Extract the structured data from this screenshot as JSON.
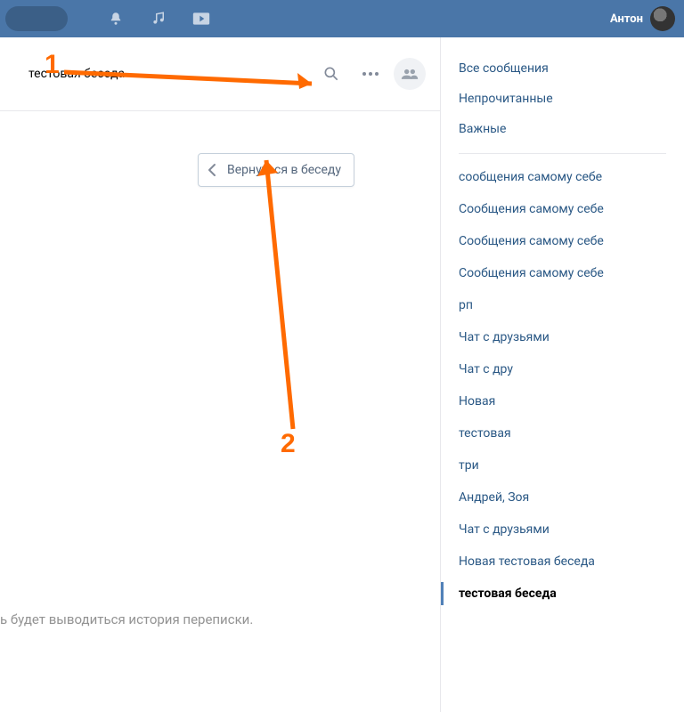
{
  "header": {
    "username": "Антон"
  },
  "chat": {
    "title": "тестовая беседа",
    "back_button": "Вернуться в беседу",
    "placeholder": "ь будет выводиться история переписки."
  },
  "sidebar": {
    "filters": [
      "Все сообщения",
      "Непрочитанные",
      "Важные"
    ],
    "chats": [
      {
        "label": "сообщения самому себе",
        "active": false
      },
      {
        "label": "Сообщения самому себе",
        "active": false
      },
      {
        "label": "Сообщения самому себе",
        "active": false
      },
      {
        "label": "Сообщения самому себе",
        "active": false
      },
      {
        "label": "рп",
        "active": false
      },
      {
        "label": "Чат с друзьями",
        "active": false
      },
      {
        "label": "Чат с дру",
        "active": false
      },
      {
        "label": "Новая",
        "active": false
      },
      {
        "label": "тестовая",
        "active": false
      },
      {
        "label": "три",
        "active": false
      },
      {
        "label": "Андрей, Зоя",
        "active": false
      },
      {
        "label": "Чат с друзьями",
        "active": false
      },
      {
        "label": "Новая тестовая беседа",
        "active": false
      },
      {
        "label": "тестовая беседа",
        "active": true
      }
    ]
  },
  "annotations": {
    "one": "1",
    "two": "2"
  }
}
